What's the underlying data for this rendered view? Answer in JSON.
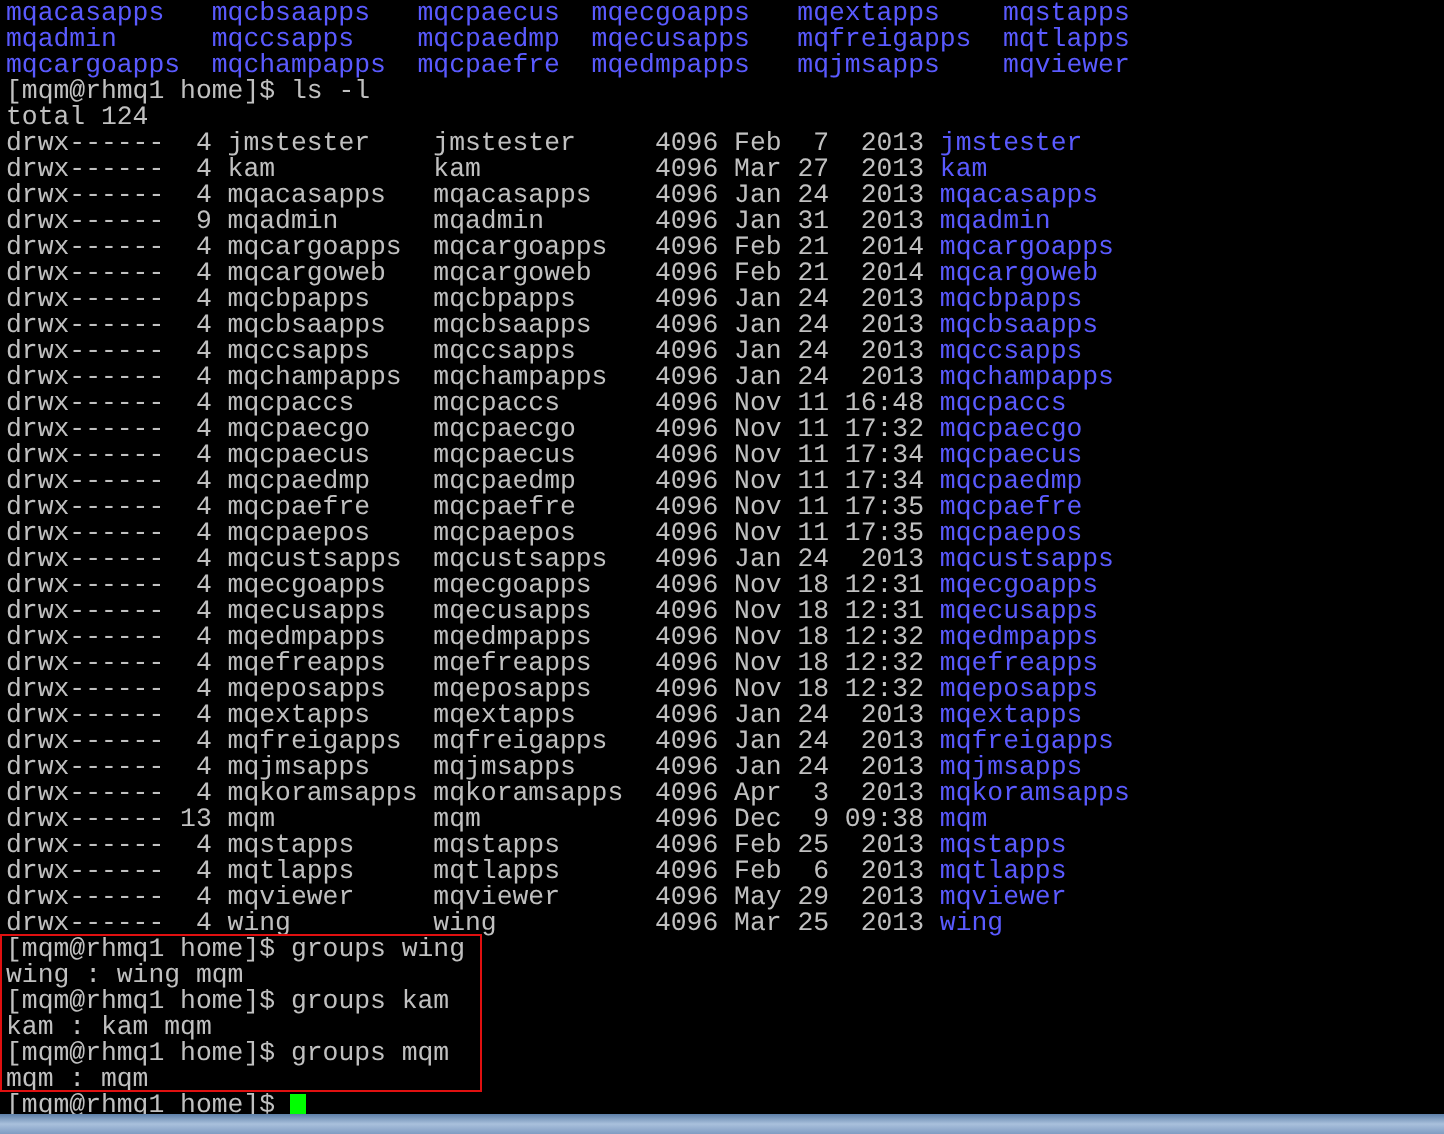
{
  "top_listing": [
    [
      "mqacasapps",
      "mqcbsaapps",
      "mqcpaecus",
      "mqecgoapps",
      "mqextapps",
      "mqstapps"
    ],
    [
      "mqadmin",
      "mqccsapps",
      "mqcpaedmp",
      "mqecusapps",
      "mqfreigapps",
      "mqtlapps"
    ],
    [
      "mqcargoapps",
      "mqchampapps",
      "mqcpaefre",
      "mqedmpapps",
      "mqjmsapps",
      "mqviewer"
    ]
  ],
  "lines": [
    {
      "kind": "command",
      "prompt": "[mqm@rhmq1 home]$",
      "command": "ls -l"
    },
    {
      "kind": "output",
      "text": "total 124"
    },
    {
      "kind": "entry",
      "details": "drwx------  4 jmstester    jmstester     4096 Feb  7  2013",
      "name": "jmstester"
    },
    {
      "kind": "entry",
      "details": "drwx------  4 kam          kam           4096 Mar 27  2013",
      "name": "kam"
    },
    {
      "kind": "entry",
      "details": "drwx------  4 mqacasapps   mqacasapps    4096 Jan 24  2013",
      "name": "mqacasapps"
    },
    {
      "kind": "entry",
      "details": "drwx------  9 mqadmin      mqadmin       4096 Jan 31  2013",
      "name": "mqadmin"
    },
    {
      "kind": "entry",
      "details": "drwx------  4 mqcargoapps  mqcargoapps   4096 Feb 21  2014",
      "name": "mqcargoapps"
    },
    {
      "kind": "entry",
      "details": "drwx------  4 mqcargoweb   mqcargoweb    4096 Feb 21  2014",
      "name": "mqcargoweb"
    },
    {
      "kind": "entry",
      "details": "drwx------  4 mqcbpapps    mqcbpapps     4096 Jan 24  2013",
      "name": "mqcbpapps"
    },
    {
      "kind": "entry",
      "details": "drwx------  4 mqcbsaapps   mqcbsaapps    4096 Jan 24  2013",
      "name": "mqcbsaapps"
    },
    {
      "kind": "entry",
      "details": "drwx------  4 mqccsapps    mqccsapps     4096 Jan 24  2013",
      "name": "mqccsapps"
    },
    {
      "kind": "entry",
      "details": "drwx------  4 mqchampapps  mqchampapps   4096 Jan 24  2013",
      "name": "mqchampapps"
    },
    {
      "kind": "entry",
      "details": "drwx------  4 mqcpaccs     mqcpaccs      4096 Nov 11 16:48",
      "name": "mqcpaccs"
    },
    {
      "kind": "entry",
      "details": "drwx------  4 mqcpaecgo    mqcpaecgo     4096 Nov 11 17:32",
      "name": "mqcpaecgo"
    },
    {
      "kind": "entry",
      "details": "drwx------  4 mqcpaecus    mqcpaecus     4096 Nov 11 17:34",
      "name": "mqcpaecus"
    },
    {
      "kind": "entry",
      "details": "drwx------  4 mqcpaedmp    mqcpaedmp     4096 Nov 11 17:34",
      "name": "mqcpaedmp"
    },
    {
      "kind": "entry",
      "details": "drwx------  4 mqcpaefre    mqcpaefre     4096 Nov 11 17:35",
      "name": "mqcpaefre"
    },
    {
      "kind": "entry",
      "details": "drwx------  4 mqcpaepos    mqcpaepos     4096 Nov 11 17:35",
      "name": "mqcpaepos"
    },
    {
      "kind": "entry",
      "details": "drwx------  4 mqcustsapps  mqcustsapps   4096 Jan 24  2013",
      "name": "mqcustsapps"
    },
    {
      "kind": "entry",
      "details": "drwx------  4 mqecgoapps   mqecgoapps    4096 Nov 18 12:31",
      "name": "mqecgoapps"
    },
    {
      "kind": "entry",
      "details": "drwx------  4 mqecusapps   mqecusapps    4096 Nov 18 12:31",
      "name": "mqecusapps"
    },
    {
      "kind": "entry",
      "details": "drwx------  4 mqedmpapps   mqedmpapps    4096 Nov 18 12:32",
      "name": "mqedmpapps"
    },
    {
      "kind": "entry",
      "details": "drwx------  4 mqefreapps   mqefreapps    4096 Nov 18 12:32",
      "name": "mqefreapps"
    },
    {
      "kind": "entry",
      "details": "drwx------  4 mqeposapps   mqeposapps    4096 Nov 18 12:32",
      "name": "mqeposapps"
    },
    {
      "kind": "entry",
      "details": "drwx------  4 mqextapps    mqextapps     4096 Jan 24  2013",
      "name": "mqextapps"
    },
    {
      "kind": "entry",
      "details": "drwx------  4 mqfreigapps  mqfreigapps   4096 Jan 24  2013",
      "name": "mqfreigapps"
    },
    {
      "kind": "entry",
      "details": "drwx------  4 mqjmsapps    mqjmsapps     4096 Jan 24  2013",
      "name": "mqjmsapps"
    },
    {
      "kind": "entry",
      "details": "drwx------  4 mqkoramsapps mqkoramsapps  4096 Apr  3  2013",
      "name": "mqkoramsapps"
    },
    {
      "kind": "entry",
      "details": "drwx------ 13 mqm          mqm           4096 Dec  9 09:38",
      "name": "mqm"
    },
    {
      "kind": "entry",
      "details": "drwx------  4 mqstapps     mqstapps      4096 Feb 25  2013",
      "name": "mqstapps"
    },
    {
      "kind": "entry",
      "details": "drwx------  4 mqtlapps     mqtlapps      4096 Feb  6  2013",
      "name": "mqtlapps"
    },
    {
      "kind": "entry",
      "details": "drwx------  4 mqviewer     mqviewer      4096 May 29  2013",
      "name": "mqviewer"
    },
    {
      "kind": "entry",
      "details": "drwx------  4 wing         wing          4096 Mar 25  2013",
      "name": "wing"
    },
    {
      "kind": "command",
      "prompt": "[mqm@rhmq1 home]$",
      "command": "groups wing"
    },
    {
      "kind": "output",
      "text": "wing : wing mqm"
    },
    {
      "kind": "command",
      "prompt": "[mqm@rhmq1 home]$",
      "command": "groups kam"
    },
    {
      "kind": "output",
      "text": "kam : kam mqm"
    },
    {
      "kind": "command",
      "prompt": "[mqm@rhmq1 home]$",
      "command": "groups mqm"
    },
    {
      "kind": "output",
      "text": "mqm : mqm"
    },
    {
      "kind": "command",
      "prompt": "[mqm@rhmq1 home]$",
      "cursor": true
    }
  ]
}
